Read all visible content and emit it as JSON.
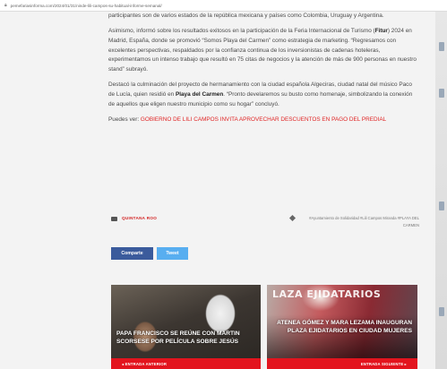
{
  "browser": {
    "url": "pemefariasinforma.com/2024/01/31/ninde-lili-campos-su-habitual-informe-semanal/",
    "lock_icon": "lock-icon"
  },
  "article": {
    "p1": "participantes son de varios estados de la república mexicana y países como Colombia, Uruguay y Argentina.",
    "p2_a": "Asimismo, informó sobre los resultados exitosos en la participación de la Feria Internacional de Turismo (",
    "p2_bold": "Fitur",
    "p2_b": ") 2024 en Madrid, España, donde se promovió “Somos Playa del Carmen” como estrategia de marketing. “Regresamos con excelentes perspectivas, respaldados por la confianza continua de los inversionistas de cadenas hoteleras, experimentamos un intenso trabajo que resultó en 75 citas de negocios y la atención de más de 900 personas en nuestro stand” subrayó.",
    "p3_a": "Destacó la culminación del proyecto de hermanamiento con la ciudad española Algeciras, ciudad natal del músico Paco de Lucía, quien residió en ",
    "p3_bold": "Playa del Carmen",
    "p3_b": ". “Pronto develaremos su busto como homenaje, simbolizando la conexión de aquellos que eligen nuestro municipio como su hogar” concluyó.",
    "p4_prefix": "Puedes ver: ",
    "p4_link": "GOBIERNO DE LILI CAMPOS INVITA APROVECHAR DESCUENTOS EN PAGO DEL PREDIAL"
  },
  "meta": {
    "category": "QUINTANA ROO",
    "tags": "#Ayuntamiento de Solidaridad  #Lili Campos Miranda  #PLAYA DEL CARMEN"
  },
  "share": {
    "facebook_label": "Comparte",
    "twitter_label": "Tweet"
  },
  "related": [
    {
      "title": "PAPA FRANCISCO SE REÚNE CON MARTIN SCORSESE POR PELÍCULA SOBRE JESÚS",
      "nav_label": "◂  ENTRADA ANTERIOR"
    },
    {
      "title": "ATENEA GÓMEZ Y MARA LEZAMA INAUGURAN PLAZA EJIDATARIOS EN CIUDAD MUJERES",
      "banner": "LAZA  EJIDATARIOS",
      "nav_label": "ENTRADA SIGUIENTE  ▸"
    }
  ],
  "colors": {
    "accent_red": "#e02424",
    "facebook_blue": "#3b5b9c",
    "twitter_blue": "#58aef0"
  }
}
